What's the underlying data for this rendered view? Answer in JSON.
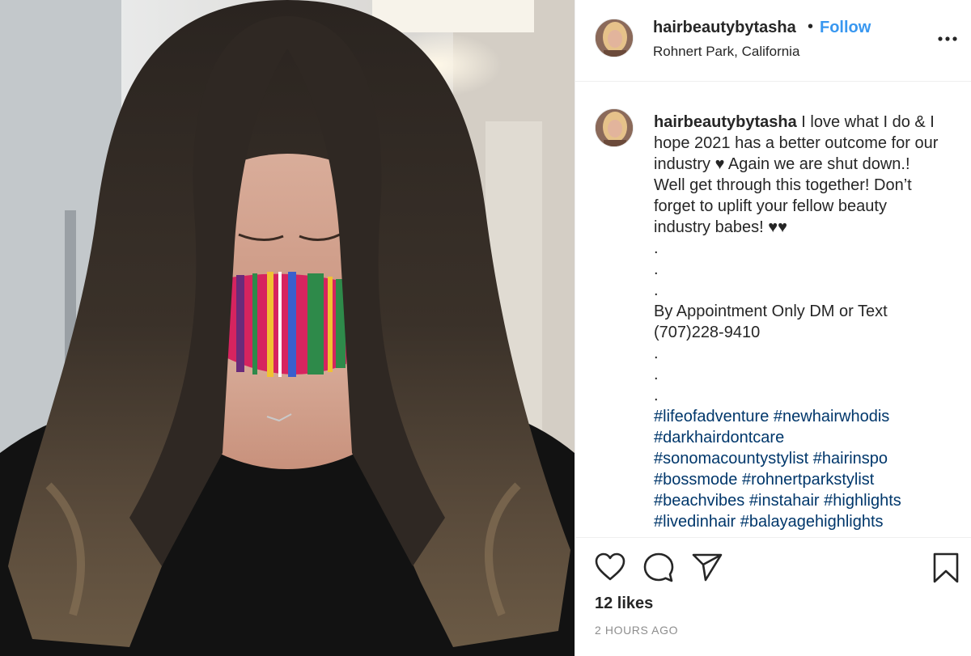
{
  "post": {
    "image": {
      "alt": "",
      "mask_colors": [
        "#d6245f",
        "#2e8a4a",
        "#f1c232",
        "#6a2b7a",
        "#ffffff",
        "#3a5fcd"
      ]
    },
    "header": {
      "username": "hairbeautybytasha",
      "separator": "•",
      "follow_label": "Follow",
      "location": "Rohnert Park, California",
      "more_icon": "more-horizontal-icon"
    },
    "caption": {
      "username": "hairbeautybytasha",
      "text_lines": [
        "I love what I do & I",
        "hope 2021 has a better outcome for our",
        "industry ♥ Again we are shut down.!",
        "Well get through this together! Don’t",
        "forget to uplift your fellow beauty",
        "industry babes! ♥♥",
        ".",
        ".",
        ".",
        "By Appointment Only DM or Text",
        "(707)228-9410",
        ".",
        ".",
        "."
      ],
      "hashtag_lines": [
        [
          "#lifeofadventure",
          "#newhairwhodis"
        ],
        [
          "#darkhairdontcare"
        ],
        [
          "#sonomacountystylist",
          "#hairinspo"
        ],
        [
          "#bossmode",
          "#rohnertparkstylist"
        ],
        [
          "#beachvibes",
          "#instahair",
          "#highlights"
        ],
        [
          "#livedinhair",
          "#balayagehighlights"
        ]
      ]
    },
    "actions": {
      "like_icon": "heart-icon",
      "comment_icon": "comment-icon",
      "share_icon": "send-icon",
      "save_icon": "bookmark-icon"
    },
    "likes_label": "12 likes",
    "timestamp": "2 HOURS AGO"
  },
  "colors": {
    "follow_blue": "#3897f0",
    "hashtag_blue": "#00376b",
    "muted_gray": "#8e8e8e",
    "text": "#262626"
  }
}
